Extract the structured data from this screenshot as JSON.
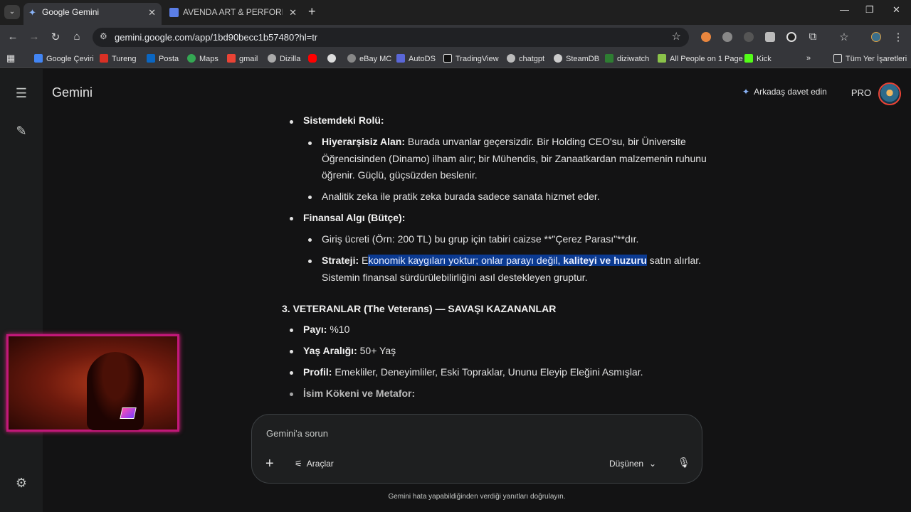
{
  "browser": {
    "tabs": [
      {
        "title": "Google Gemini",
        "active": true
      },
      {
        "title": "AVENDA ART & PERFORMANCE",
        "active": false
      }
    ],
    "url": "gemini.google.com/app/1bd90becc1b57480?hl=tr",
    "bookmarks": [
      "Google Çeviri",
      "Tureng",
      "Posta",
      "Maps",
      "gmail",
      "Dizilla",
      "",
      "",
      "eBay MC",
      "AutoDS",
      "TradingView",
      "chatgpt",
      "SteamDB",
      "diziwatch",
      "All People on 1 Page",
      "Kick"
    ],
    "all_bookmarks": "Tüm Yer İşaretleri"
  },
  "app": {
    "brand": "Gemini",
    "invite": "Arkadaş davet edin",
    "plan": "PRO"
  },
  "content": {
    "role_heading": "Sistemdeki Rolü:",
    "hier_label": "Hiyerarşisiz Alan:",
    "hier_text1": " Burada unvanlar geçersizdir. Bir Holding CEO'su, bir Üniversite",
    "hier_text2": "Öğrencisinden (Dinamo) ilham alır; bir Mühendis, bir Zanaatkardan malzemenin ruhunu",
    "hier_text3": "öğrenir. Güçlü, güçsüzden beslenir.",
    "analytic": "Analitik zeka ile pratik zeka burada sadece sanata hizmet eder.",
    "finance_heading": "Finansal Algı (Bütçe):",
    "fee_text": "Giriş ücreti (Örn: 200 TL) bu grup için tabiri caizse **\"Çerez Parası\"**dır.",
    "strategy_label": "Strateji:",
    "strategy_pre": " E",
    "strategy_hl1": "konomik kaygıları yoktur; onlar parayı değil, ",
    "strategy_hl_bold": "kaliteyi ve huzuru",
    "strategy_post": " satın alırlar.",
    "strategy_line2": "Sistemin finansal sürdürülebilirliğini asıl destekleyen gruptur.",
    "section3": "3. VETERANLAR (The Veterans) — SAVAŞI KAZANANLAR",
    "share_label": "Payı:",
    "share_val": " %10",
    "age_label": "Yaş Aralığı:",
    "age_val": " 50+ Yaş",
    "profile_label": "Profil:",
    "profile_val": " Emekliler, Deneyimliler, Eski Topraklar, Ununu Eleyip Eleğini Asmışlar.",
    "origin_label": "İsim Kökeni ve Metafor:"
  },
  "composer": {
    "placeholder": "Gemini'a sorun",
    "tools": "Araçlar",
    "mode": "Düşünen"
  },
  "disclaimer": "Gemini hata yapabildiğinden verdiği yanıtları doğrulayın."
}
